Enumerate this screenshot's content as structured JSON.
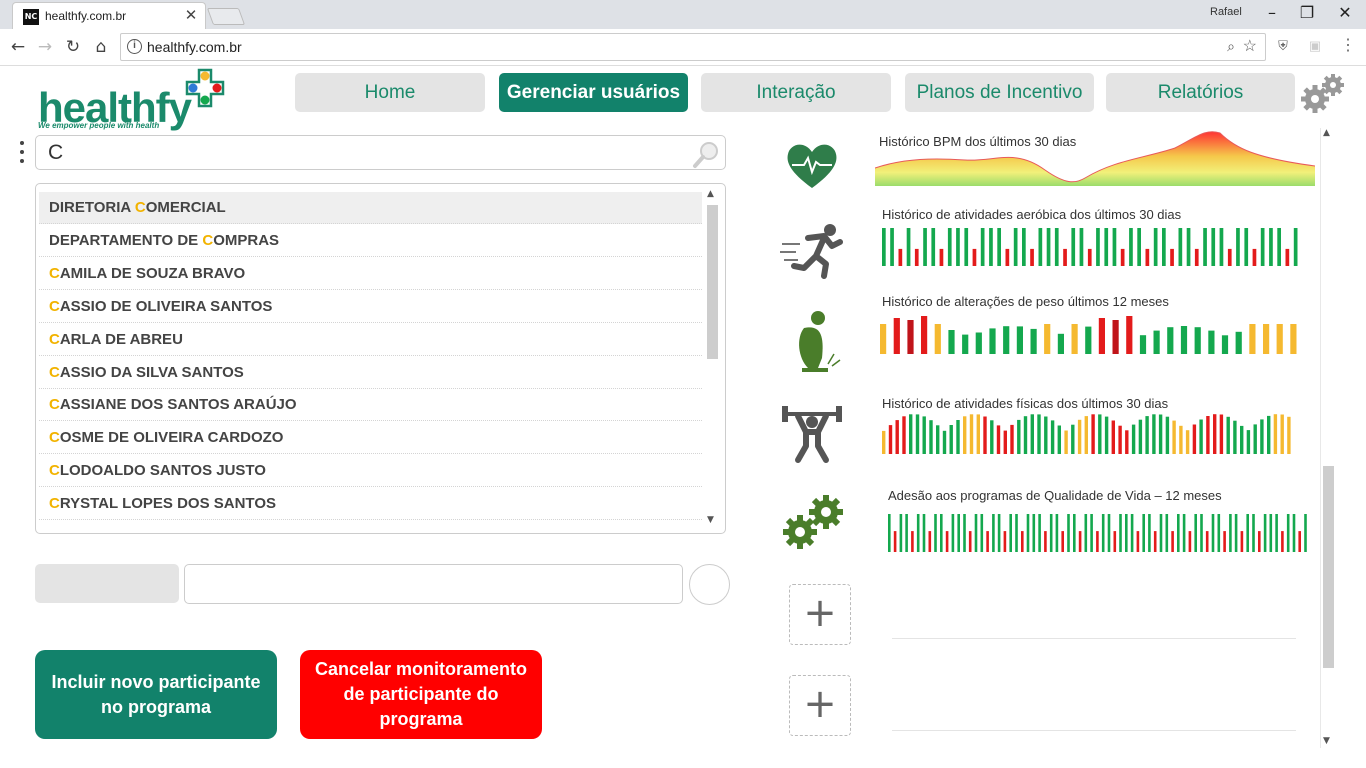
{
  "browser": {
    "tab_title": "healthfy.com.br",
    "favicon_text": "NC",
    "user": "Rafael",
    "url": "healthfy.com.br"
  },
  "logo": {
    "name": "healthfy",
    "tagline": "We empower people with health"
  },
  "nav": [
    {
      "label": "Home",
      "active": false
    },
    {
      "label": "Gerenciar usuários",
      "active": true
    },
    {
      "label": "Interação",
      "active": false
    },
    {
      "label": "Planos de Incentivo",
      "active": false
    },
    {
      "label": "Relatórios",
      "active": false
    }
  ],
  "search": {
    "value": "C"
  },
  "results": [
    {
      "pre": "DIRETORIA ",
      "hl": "C",
      "post": "OMERCIAL",
      "selected": true
    },
    {
      "pre": "DEPARTAMENTO DE ",
      "hl": "C",
      "post": "OMPRAS",
      "selected": false
    },
    {
      "pre": "",
      "hl": "C",
      "post": "AMILA DE SOUZA BRAVO",
      "selected": false
    },
    {
      "pre": "",
      "hl": "C",
      "post": "ASSIO DE OLIVEIRA SANTOS",
      "selected": false
    },
    {
      "pre": "",
      "hl": "C",
      "post": "ARLA DE ABREU",
      "selected": false
    },
    {
      "pre": "",
      "hl": "C",
      "post": "ASSIO DA SILVA SANTOS",
      "selected": false
    },
    {
      "pre": "",
      "hl": "C",
      "post": "ASSIANE DOS SANTOS ARAÚJO",
      "selected": false
    },
    {
      "pre": "",
      "hl": "C",
      "post": "OSME DE OLIVEIRA CARDOZO",
      "selected": false
    },
    {
      "pre": "",
      "hl": "C",
      "post": "LODOALDO SANTOS JUSTO",
      "selected": false
    },
    {
      "pre": "",
      "hl": "C",
      "post": "RYSTAL LOPES DOS SANTOS",
      "selected": false
    }
  ],
  "actions": {
    "add": "Incluir novo participante no programa",
    "cancel": "Cancelar monitoramento de participante do programa"
  },
  "colors": {
    "brand": "#12826b",
    "green": "#14a84e",
    "red": "#e31b1b",
    "yellow": "#f5b930",
    "darkred": "#c0141a"
  },
  "charts": [
    {
      "title": "Histórico BPM dos últimos 30 dias",
      "icon": "heart-icon",
      "type": "area"
    },
    {
      "title": "Histórico de atividades aeróbica dos últimos 30 dias",
      "icon": "runner-icon",
      "type": "bar",
      "pattern": [
        "g",
        "g",
        "r",
        "g",
        "r",
        "g",
        "g",
        "r",
        "g",
        "g",
        "g",
        "r",
        "g",
        "g",
        "g",
        "r",
        "g",
        "g",
        "r",
        "g",
        "g",
        "g",
        "r",
        "g",
        "g",
        "r",
        "g",
        "g",
        "g",
        "r",
        "g",
        "g",
        "r",
        "g",
        "g",
        "r",
        "g",
        "g",
        "r",
        "g",
        "g",
        "g",
        "r",
        "g",
        "g",
        "r",
        "g",
        "g",
        "g",
        "r",
        "g"
      ]
    },
    {
      "title": "Histórico de alterações de peso últimos 12 meses",
      "icon": "scale-person-icon",
      "type": "bar",
      "pattern": [
        "y",
        "r",
        "d",
        "r",
        "y",
        "g",
        "g",
        "g",
        "g",
        "g",
        "g",
        "g",
        "y",
        "g",
        "y",
        "g",
        "r",
        "d",
        "r",
        "g",
        "g",
        "g",
        "g",
        "g",
        "g",
        "g",
        "g",
        "y",
        "y",
        "y",
        "y"
      ]
    },
    {
      "title": "Histórico de atividades físicas dos últimos 30 dias",
      "icon": "weightlifter-icon",
      "type": "bar",
      "pattern": [
        "y",
        "r",
        "r",
        "r",
        "g",
        "g",
        "g",
        "g",
        "g",
        "g",
        "g",
        "g",
        "y",
        "y",
        "y",
        "r",
        "g",
        "r",
        "r",
        "r",
        "g",
        "g",
        "g",
        "g",
        "g",
        "g",
        "g",
        "y",
        "g",
        "y",
        "y",
        "r",
        "g",
        "g",
        "r",
        "r",
        "r",
        "g",
        "g",
        "g",
        "g",
        "g",
        "g",
        "y",
        "y",
        "y",
        "r",
        "g",
        "r",
        "r",
        "r",
        "g",
        "g",
        "g",
        "g",
        "g",
        "g",
        "g",
        "y",
        "y",
        "y"
      ]
    },
    {
      "title": "Adesão aos programas de Qualidade de Vida – 12 meses",
      "icon": "gears-icon",
      "type": "bar",
      "pattern": [
        "g",
        "r",
        "g",
        "g",
        "r",
        "g",
        "g",
        "r",
        "g",
        "g",
        "r",
        "g",
        "g",
        "g",
        "r",
        "g",
        "g",
        "r",
        "g",
        "g",
        "r",
        "g",
        "g",
        "r",
        "g",
        "g",
        "g",
        "r",
        "g",
        "g",
        "r",
        "g",
        "g",
        "r",
        "g",
        "g",
        "r",
        "g",
        "g",
        "r",
        "g",
        "g",
        "g",
        "r",
        "g",
        "g",
        "r",
        "g",
        "g",
        "r",
        "g",
        "g",
        "r",
        "g",
        "g",
        "r",
        "g",
        "g",
        "r",
        "g",
        "g",
        "r",
        "g",
        "g",
        "r",
        "g",
        "g",
        "g",
        "r",
        "g",
        "g",
        "r",
        "g"
      ]
    }
  ],
  "add_slots": [
    "+",
    "+"
  ]
}
